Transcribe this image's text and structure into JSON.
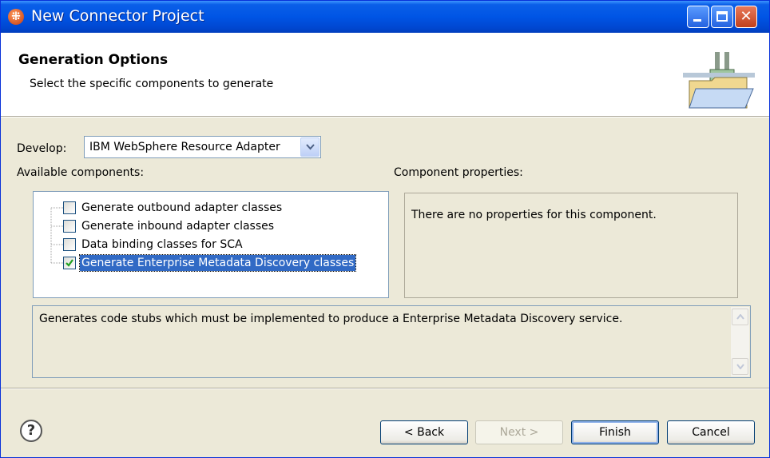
{
  "window": {
    "title": "New Connector Project"
  },
  "banner": {
    "title": "Generation Options",
    "description": "Select the specific components to generate",
    "icon": "folder-plug-icon"
  },
  "develop": {
    "label": "Develop:",
    "selected": "IBM WebSphere Resource Adapter"
  },
  "available": {
    "label": "Available components:",
    "items": [
      {
        "label": "Generate outbound adapter classes",
        "checked": false,
        "selected": false
      },
      {
        "label": "Generate inbound adapter classes",
        "checked": false,
        "selected": false
      },
      {
        "label": "Data binding classes for SCA",
        "checked": false,
        "selected": false
      },
      {
        "label": "Generate Enterprise Metadata Discovery classes",
        "checked": true,
        "selected": true
      }
    ]
  },
  "properties": {
    "label": "Component properties:",
    "text": "There are no properties for this component."
  },
  "description": {
    "text": "Generates code stubs which must be implemented to produce a Enterprise Metadata Discovery service."
  },
  "buttons": {
    "back": "< Back",
    "next": "Next >",
    "finish": "Finish",
    "cancel": "Cancel",
    "help": "?"
  },
  "colors": {
    "titlebar": "#0055e5",
    "selection": "#316ac5",
    "dialog_bg": "#ece9d8"
  }
}
